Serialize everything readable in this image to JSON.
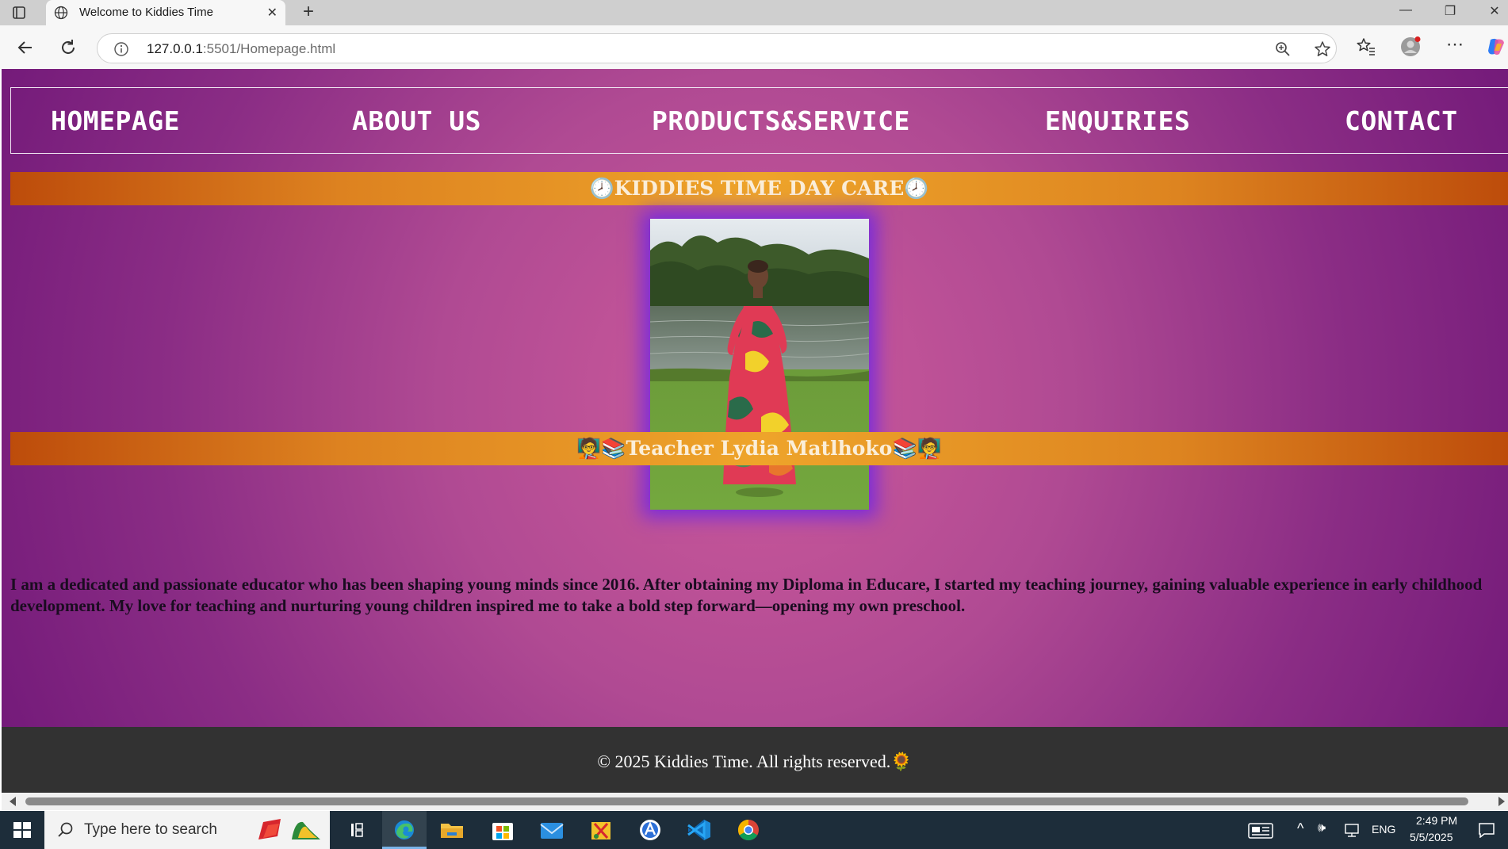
{
  "browser": {
    "tab_title": "Welcome to Kiddies Time",
    "url_host": "127.0.0.1",
    "url_path": ":5501/Homepage.html"
  },
  "nav": {
    "items": [
      "HOMEPAGE",
      "ABOUT US",
      "PRODUCTS&SERVICE",
      "ENQUIRIES",
      "CONTACT"
    ]
  },
  "header": {
    "icon_left": "🕗",
    "title": "KIDDIES TIME DAY CARE",
    "icon_right": "🕗"
  },
  "profile": {
    "icon_left": "🧑‍🏫📚",
    "name": "Teacher Lydia Matlhoko",
    "icon_right": "📚🧑‍🏫",
    "bio": "I am a dedicated and passionate educator who has been shaping young minds since 2016. After obtaining my Diploma in Educare, I started my teaching journey, gaining valuable experience in early childhood development. My love for teaching and nurturing young children inspired me to take a bold step forward—opening my own preschool."
  },
  "footer": {
    "text": "© 2025 Kiddies Time. All rights reserved.",
    "icon": "🌻"
  },
  "taskbar": {
    "search_placeholder": "Type here to search",
    "language": "ENG",
    "time": "2:49 PM",
    "date": "5/5/2025"
  },
  "colors": {
    "page_purple": "#8b2d85",
    "page_pink": "#cd5a9b",
    "banner_orange": "#eea42a",
    "footer_bg": "#323232",
    "photo_glow": "#7328e1"
  }
}
